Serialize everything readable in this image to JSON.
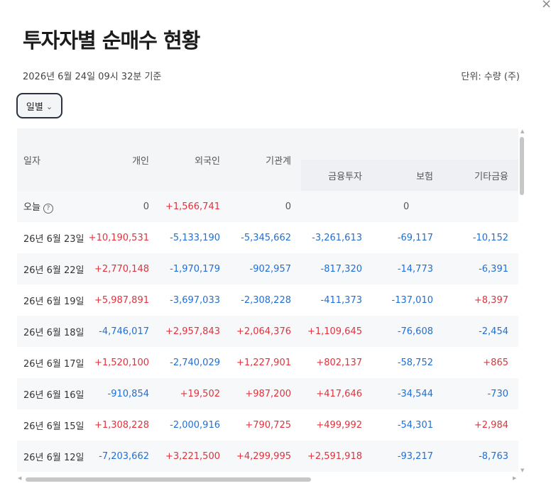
{
  "title": "투자자별 순매수 현황",
  "timestamp": "2026년 6월 24일 09시 32분 기준",
  "unit": "단위: 수량 (주)",
  "period_select": {
    "label": "일별",
    "icon": "chevron-down-icon"
  },
  "close_icon": "close-icon",
  "colors": {
    "positive": "#e1323c",
    "negative": "#1f6fd6",
    "header_bg": "#f4f5f7"
  },
  "table": {
    "columns": {
      "date": "일자",
      "individual": "개인",
      "foreign": "외국인",
      "institution": "기관계",
      "financial_investment": "금융투자",
      "insurance": "보험",
      "other_finance": "기타금융"
    },
    "today": {
      "label": "오늘",
      "help_icon": "help-circle-icon",
      "individual": "0",
      "foreign": "+1,566,741",
      "institution": "0",
      "sub_total": "0"
    },
    "rows": [
      {
        "date": "26년 6월 23일",
        "individual": "+10,190,531",
        "foreign": "-5,133,190",
        "institution": "-5,345,662",
        "financial_investment": "-3,261,613",
        "insurance": "-69,117",
        "other_finance": "-10,152"
      },
      {
        "date": "26년 6월 22일",
        "individual": "+2,770,148",
        "foreign": "-1,970,179",
        "institution": "-902,957",
        "financial_investment": "-817,320",
        "insurance": "-14,773",
        "other_finance": "-6,391"
      },
      {
        "date": "26년 6월 19일",
        "individual": "+5,987,891",
        "foreign": "-3,697,033",
        "institution": "-2,308,228",
        "financial_investment": "-411,373",
        "insurance": "-137,010",
        "other_finance": "+8,397"
      },
      {
        "date": "26년 6월 18일",
        "individual": "-4,746,017",
        "foreign": "+2,957,843",
        "institution": "+2,064,376",
        "financial_investment": "+1,109,645",
        "insurance": "-76,608",
        "other_finance": "-2,454"
      },
      {
        "date": "26년 6월 17일",
        "individual": "+1,520,100",
        "foreign": "-2,740,029",
        "institution": "+1,227,901",
        "financial_investment": "+802,137",
        "insurance": "-58,752",
        "other_finance": "+865"
      },
      {
        "date": "26년 6월 16일",
        "individual": "-910,854",
        "foreign": "+19,502",
        "institution": "+987,200",
        "financial_investment": "+417,646",
        "insurance": "-34,544",
        "other_finance": "-730"
      },
      {
        "date": "26년 6월 15일",
        "individual": "+1,308,228",
        "foreign": "-2,000,916",
        "institution": "+790,725",
        "financial_investment": "+499,992",
        "insurance": "-54,301",
        "other_finance": "+2,984"
      },
      {
        "date": "26년 6월 12일",
        "individual": "-7,203,662",
        "foreign": "+3,221,500",
        "institution": "+4,299,995",
        "financial_investment": "+2,591,918",
        "insurance": "-93,217",
        "other_finance": "-8,763"
      }
    ]
  }
}
